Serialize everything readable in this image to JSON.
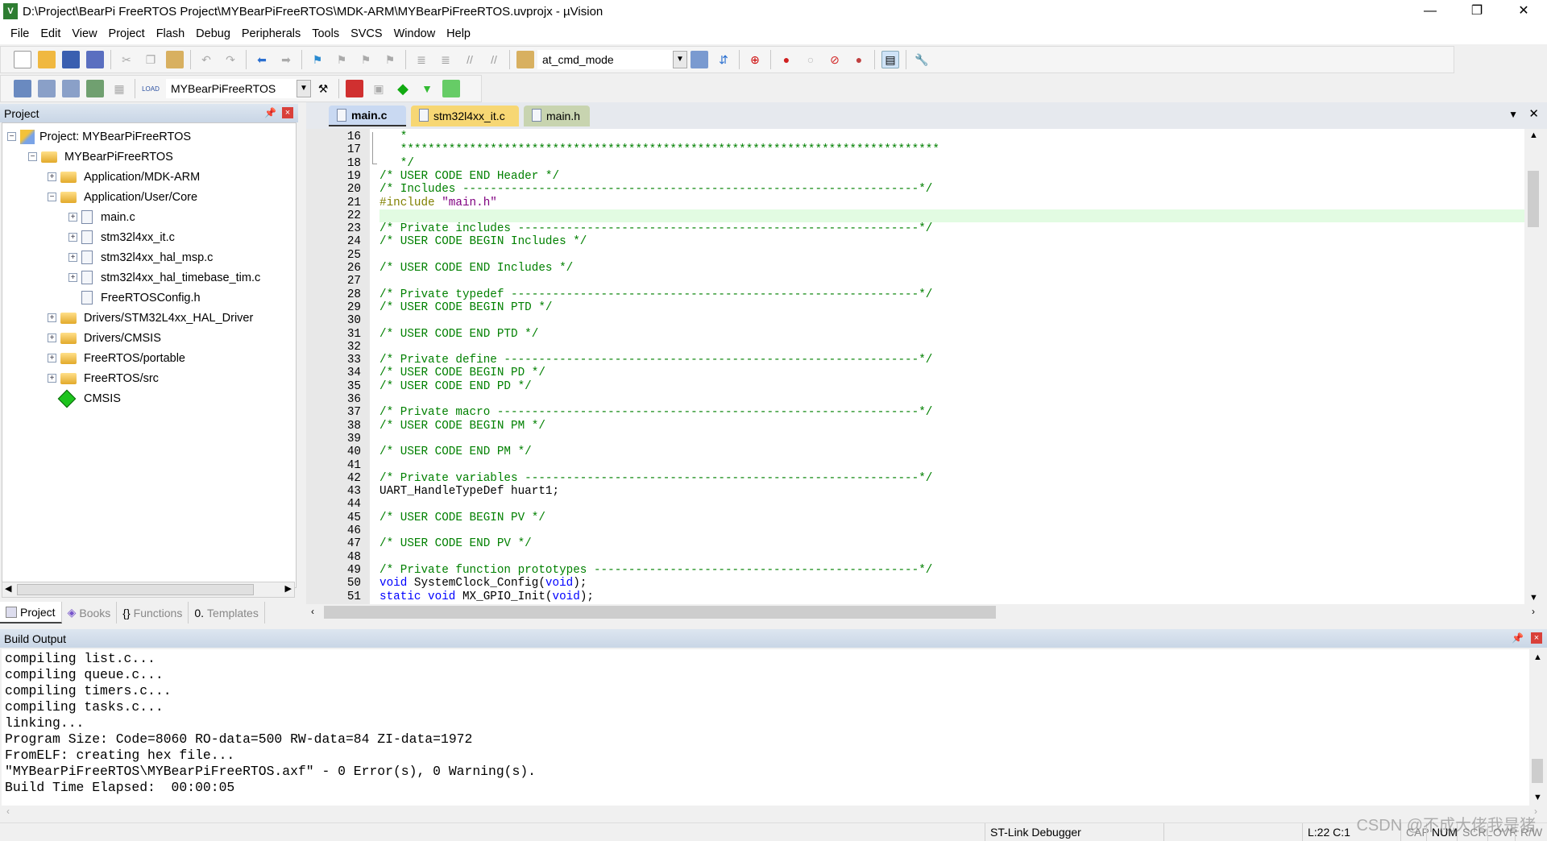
{
  "window": {
    "title": "D:\\Project\\BearPi FreeRTOS Project\\MYBearPiFreeRTOS\\MDK-ARM\\MYBearPiFreeRTOS.uvprojx - µVision",
    "minimize": "—",
    "restore": "❐",
    "close": "✕"
  },
  "menu": [
    "File",
    "Edit",
    "View",
    "Project",
    "Flash",
    "Debug",
    "Peripherals",
    "Tools",
    "SVCS",
    "Window",
    "Help"
  ],
  "toolbar1": {
    "find_combo": "at_cmd_mode"
  },
  "toolbar2": {
    "target_combo": "MYBearPiFreeRTOS",
    "load_label": "LOAD"
  },
  "project_panel": {
    "title": "Project",
    "tree": [
      {
        "label": "Project: MYBearPiFreeRTOS",
        "level": 0,
        "expander": "−",
        "icon": "project-icon"
      },
      {
        "label": "MYBearPiFreeRTOS",
        "level": 1,
        "expander": "−",
        "icon": "target-folder-icon"
      },
      {
        "label": "Application/MDK-ARM",
        "level": 2,
        "expander": "+",
        "icon": "folder-icon"
      },
      {
        "label": "Application/User/Core",
        "level": 2,
        "expander": "−",
        "icon": "folder-open-icon"
      },
      {
        "label": "main.c",
        "level": 3,
        "expander": "+",
        "icon": "file-icon"
      },
      {
        "label": "stm32l4xx_it.c",
        "level": 3,
        "expander": "+",
        "icon": "file-icon"
      },
      {
        "label": "stm32l4xx_hal_msp.c",
        "level": 3,
        "expander": "+",
        "icon": "file-icon"
      },
      {
        "label": "stm32l4xx_hal_timebase_tim.c",
        "level": 3,
        "expander": "+",
        "icon": "file-icon"
      },
      {
        "label": "FreeRTOSConfig.h",
        "level": 3,
        "expander": "",
        "icon": "file-icon"
      },
      {
        "label": "Drivers/STM32L4xx_HAL_Driver",
        "level": 2,
        "expander": "+",
        "icon": "folder-icon"
      },
      {
        "label": "Drivers/CMSIS",
        "level": 2,
        "expander": "+",
        "icon": "folder-icon"
      },
      {
        "label": "FreeRTOS/portable",
        "level": 2,
        "expander": "+",
        "icon": "folder-icon"
      },
      {
        "label": "FreeRTOS/src",
        "level": 2,
        "expander": "+",
        "icon": "folder-icon"
      },
      {
        "label": "CMSIS",
        "level": 2,
        "expander": "",
        "icon": "cmsis-diamond-icon"
      }
    ],
    "bottom_tabs": [
      "Project",
      "Books",
      "Functions",
      "Templates"
    ]
  },
  "editor": {
    "tabs": [
      {
        "label": "main.c",
        "active": true,
        "color": "#c9d9f2"
      },
      {
        "label": "stm32l4xx_it.c",
        "active": false,
        "color": "#f7d774"
      },
      {
        "label": "main.h",
        "active": false,
        "color": "#c8d4b0"
      }
    ],
    "current_line": 22,
    "lines": [
      {
        "n": "16",
        "p": [
          [
            "cmt",
            "   *"
          ]
        ]
      },
      {
        "n": "17",
        "p": [
          [
            "cmt",
            "   ******************************************************************************"
          ]
        ]
      },
      {
        "n": "18",
        "p": [
          [
            "cmt",
            "   */"
          ]
        ]
      },
      {
        "n": "19",
        "p": [
          [
            "cmt",
            "/* USER CODE END Header */"
          ]
        ]
      },
      {
        "n": "20",
        "p": [
          [
            "cmt",
            "/* Includes ------------------------------------------------------------------*/"
          ]
        ]
      },
      {
        "n": "21",
        "p": [
          [
            "pp",
            "#include "
          ],
          [
            "str",
            "\"main.h\""
          ]
        ]
      },
      {
        "n": "22",
        "p": []
      },
      {
        "n": "23",
        "p": [
          [
            "cmt",
            "/* Private includes ----------------------------------------------------------*/"
          ]
        ]
      },
      {
        "n": "24",
        "p": [
          [
            "cmt",
            "/* USER CODE BEGIN Includes */"
          ]
        ]
      },
      {
        "n": "25",
        "p": []
      },
      {
        "n": "26",
        "p": [
          [
            "cmt",
            "/* USER CODE END Includes */"
          ]
        ]
      },
      {
        "n": "27",
        "p": []
      },
      {
        "n": "28",
        "p": [
          [
            "cmt",
            "/* Private typedef -----------------------------------------------------------*/"
          ]
        ]
      },
      {
        "n": "29",
        "p": [
          [
            "cmt",
            "/* USER CODE BEGIN PTD */"
          ]
        ]
      },
      {
        "n": "30",
        "p": []
      },
      {
        "n": "31",
        "p": [
          [
            "cmt",
            "/* USER CODE END PTD */"
          ]
        ]
      },
      {
        "n": "32",
        "p": []
      },
      {
        "n": "33",
        "p": [
          [
            "cmt",
            "/* Private define ------------------------------------------------------------*/"
          ]
        ]
      },
      {
        "n": "34",
        "p": [
          [
            "cmt",
            "/* USER CODE BEGIN PD */"
          ]
        ]
      },
      {
        "n": "35",
        "p": [
          [
            "cmt",
            "/* USER CODE END PD */"
          ]
        ]
      },
      {
        "n": "36",
        "p": []
      },
      {
        "n": "37",
        "p": [
          [
            "cmt",
            "/* Private macro -------------------------------------------------------------*/"
          ]
        ]
      },
      {
        "n": "38",
        "p": [
          [
            "cmt",
            "/* USER CODE BEGIN PM */"
          ]
        ]
      },
      {
        "n": "39",
        "p": []
      },
      {
        "n": "40",
        "p": [
          [
            "cmt",
            "/* USER CODE END PM */"
          ]
        ]
      },
      {
        "n": "41",
        "p": []
      },
      {
        "n": "42",
        "p": [
          [
            "cmt",
            "/* Private variables ---------------------------------------------------------*/"
          ]
        ]
      },
      {
        "n": "43",
        "p": [
          [
            "tx",
            "UART_HandleTypeDef huart1;"
          ]
        ]
      },
      {
        "n": "44",
        "p": []
      },
      {
        "n": "45",
        "p": [
          [
            "cmt",
            "/* USER CODE BEGIN PV */"
          ]
        ]
      },
      {
        "n": "46",
        "p": []
      },
      {
        "n": "47",
        "p": [
          [
            "cmt",
            "/* USER CODE END PV */"
          ]
        ]
      },
      {
        "n": "48",
        "p": []
      },
      {
        "n": "49",
        "p": [
          [
            "cmt",
            "/* Private function prototypes -----------------------------------------------*/"
          ]
        ]
      },
      {
        "n": "50",
        "p": [
          [
            "kw",
            "void"
          ],
          [
            "tx",
            " SystemClock_Config("
          ],
          [
            "kw",
            "void"
          ],
          [
            "tx",
            ");"
          ]
        ]
      },
      {
        "n": "51",
        "p": [
          [
            "kw",
            "static void"
          ],
          [
            "tx",
            " MX_GPIO_Init("
          ],
          [
            "kw",
            "void"
          ],
          [
            "tx",
            ");"
          ]
        ]
      }
    ]
  },
  "build_output": {
    "title": "Build Output",
    "lines": [
      "compiling list.c...",
      "compiling queue.c...",
      "compiling timers.c...",
      "compiling tasks.c...",
      "linking...",
      "Program Size: Code=8060 RO-data=500 RW-data=84 ZI-data=1972",
      "FromELF: creating hex file...",
      "\"MYBearPiFreeRTOS\\MYBearPiFreeRTOS.axf\" - 0 Error(s), 0 Warning(s).",
      "Build Time Elapsed:  00:00:05"
    ]
  },
  "status": {
    "debugger": "ST-Link Debugger",
    "position": "L:22 C:1",
    "cap": "CAP",
    "num": "NUM",
    "scrl": "SCRL",
    "ovr": "OVR",
    "rw": "R/W"
  },
  "watermark": "CSDN @不成大佬我是猪"
}
